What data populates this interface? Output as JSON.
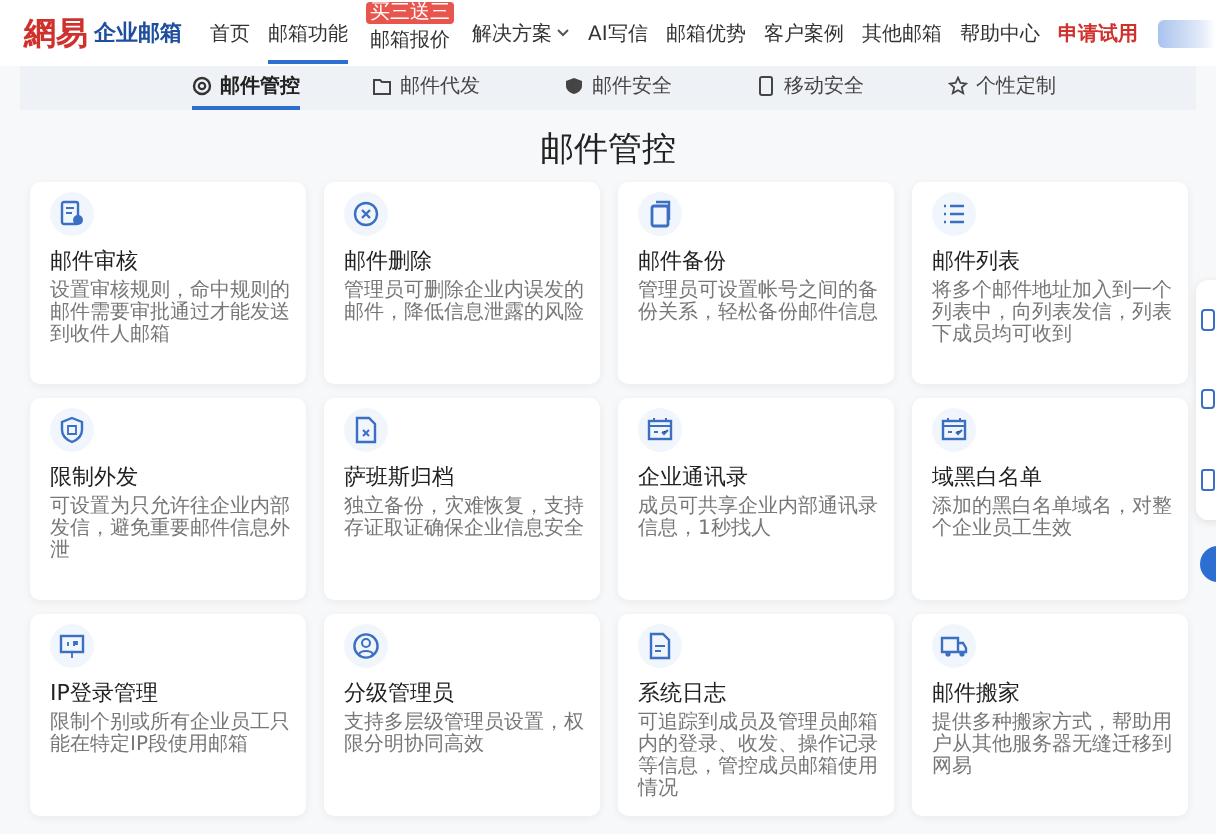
{
  "header": {
    "logo_mark": "網易",
    "logo_text": "企业邮箱",
    "nav": [
      {
        "label": "首页",
        "selected": false,
        "kind": "plain"
      },
      {
        "label": "邮箱功能",
        "selected": true,
        "kind": "plain"
      },
      {
        "label": "邮箱报价",
        "selected": false,
        "kind": "badge",
        "badge": "买三送三"
      },
      {
        "label": "解决方案",
        "selected": false,
        "kind": "dropdown"
      },
      {
        "label": "AI写信",
        "selected": false,
        "kind": "plain"
      },
      {
        "label": "邮箱优势",
        "selected": false,
        "kind": "plain"
      },
      {
        "label": "客户案例",
        "selected": false,
        "kind": "plain"
      },
      {
        "label": "其他邮箱",
        "selected": false,
        "kind": "plain"
      },
      {
        "label": "帮助中心",
        "selected": false,
        "kind": "plain"
      },
      {
        "label": "申请试用",
        "selected": false,
        "kind": "highlight"
      }
    ]
  },
  "tabs": [
    {
      "label": "邮件管控",
      "selected": true
    },
    {
      "label": "邮件代发",
      "selected": false
    },
    {
      "label": "邮件安全",
      "selected": false
    },
    {
      "label": "移动安全",
      "selected": false
    },
    {
      "label": "个性定制",
      "selected": false
    }
  ],
  "section_title": "邮件管控",
  "features": [
    {
      "title": "邮件审核",
      "description": "设置审核规则，命中规则的邮件需要审批通过才能发送到收件人邮箱"
    },
    {
      "title": "邮件删除",
      "description": "管理员可删除企业内误发的邮件，降低信息泄露的风险"
    },
    {
      "title": "邮件备份",
      "description": "管理员可设置帐号之间的备份关系，轻松备份邮件信息"
    },
    {
      "title": "邮件列表",
      "description": "将多个邮件地址加入到一个列表中，向列表发信，列表下成员均可收到"
    },
    {
      "title": "限制外发",
      "description": "可设置为只允许往企业内部发信，避免重要邮件信息外泄"
    },
    {
      "title": "萨班斯归档",
      "description": "独立备份，灾难恢复，支持存证取证确保企业信息安全"
    },
    {
      "title": "企业通讯录",
      "description": "成员可共享企业内部通讯录信息，1秒找人"
    },
    {
      "title": "域黑白名单",
      "description": "添加的黑白名单域名，对整个企业员工生效"
    },
    {
      "title": "IP登录管理",
      "description": "限制个别或所有企业员工只能在特定IP段使用邮箱"
    },
    {
      "title": "分级管理员",
      "description": "支持多层级管理员设置，权限分明协同高效"
    },
    {
      "title": "系统日志",
      "description": "可追踪到成员及管理员邮箱内的登录、收发、操作记录等信息，管控成员邮箱使用情况"
    },
    {
      "title": "邮件搬家",
      "description": "提供多种搬家方式，帮助用户从其他服务器无缝迁移到网易"
    }
  ]
}
